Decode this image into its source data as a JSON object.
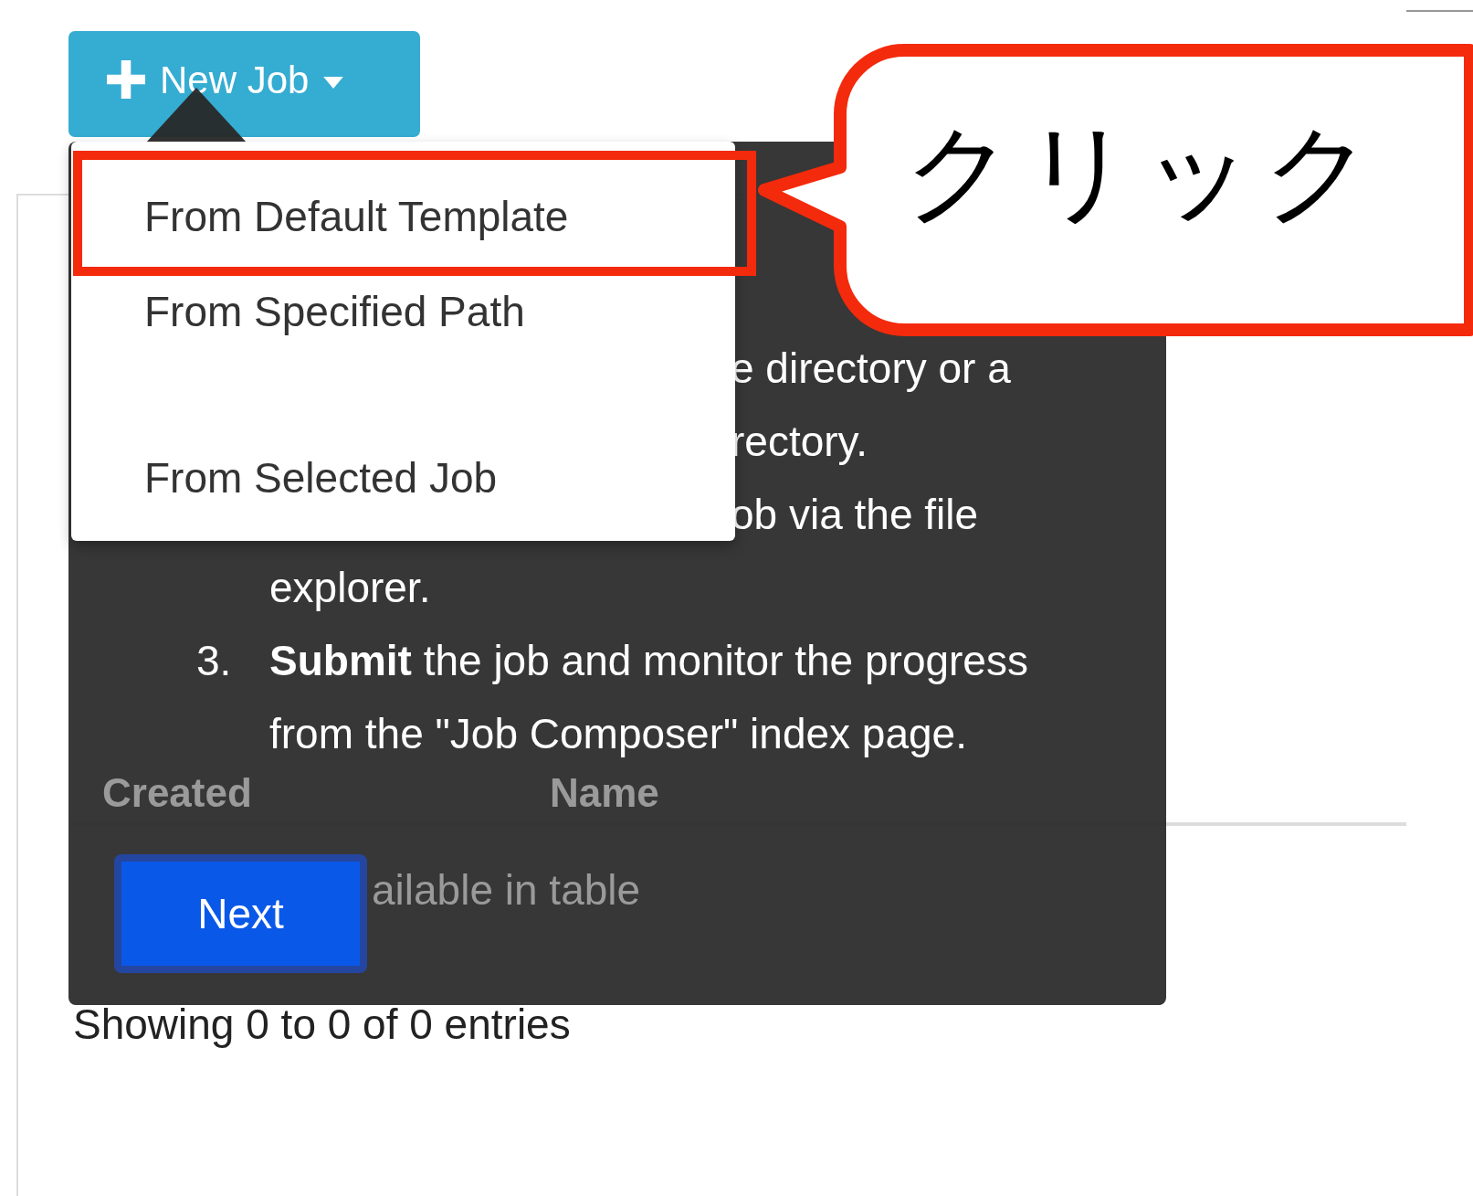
{
  "new_job_button": {
    "label": "New Job"
  },
  "dropdown_menu": {
    "groups": [
      {
        "items": [
          {
            "label": "From Default Template",
            "annotated": true
          },
          {
            "label": "From Specified Path",
            "annotated": false
          }
        ]
      },
      {
        "items": [
          {
            "label": "From Selected Job",
            "annotated": false
          }
        ]
      }
    ]
  },
  "table": {
    "columns": [
      "Created",
      "Name"
    ],
    "empty_message_parts": [
      "ailable in table"
    ],
    "info": "Showing 0 to 0 of 0 entries"
  },
  "tour_popover": {
    "step_2_fragments": [
      "e directory or a",
      "rectory.",
      "ob via the file"
    ],
    "step_2_continuation": "explorer.",
    "step_3": {
      "number": "3.",
      "text": "**Submit** the job and monitor the progress from the \"Job Composer\" index page."
    },
    "next_button": "Next"
  },
  "callout": {
    "text": "クリック"
  }
}
